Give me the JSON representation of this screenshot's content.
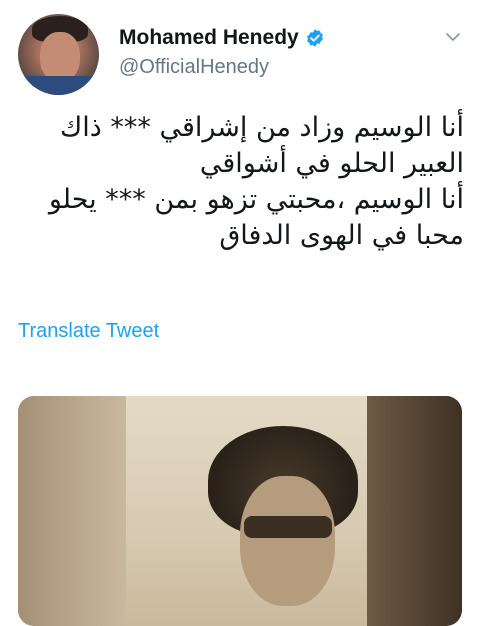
{
  "user": {
    "name": "Mohamed Henedy",
    "handle": "@OfficialHenedy"
  },
  "tweet": {
    "lines": [
      "أنا الوسيم وزاد من إشراقي *** ذاك",
      "العبير الحلو في أشواقي",
      "أنا الوسيم ،محبتي تزهو بمن *** يحلو",
      "محبا في الهوى الدفاق"
    ],
    "translate_label": "Translate Tweet"
  },
  "icons": {
    "verified": "verified-badge-icon",
    "more": "chevron-down-icon"
  },
  "colors": {
    "link": "#1da1f2",
    "secondary_text": "#657786",
    "verified": "#1da1f2"
  }
}
